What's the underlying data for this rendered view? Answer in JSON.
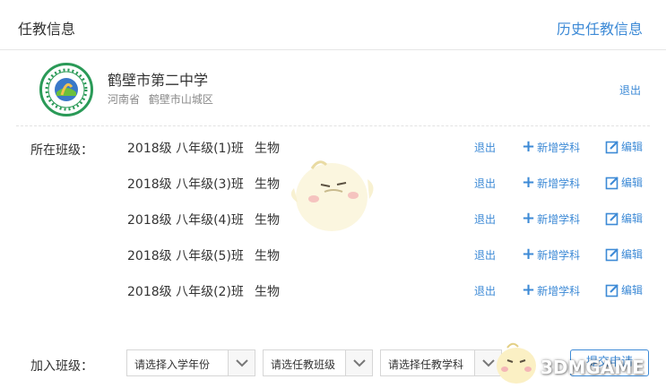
{
  "header": {
    "title": "任教信息",
    "history_link": "历史任教信息"
  },
  "school": {
    "name": "鹤壁市第二中学",
    "province": "河南省",
    "city_district": "鹤壁市山城区",
    "exit_label": "退出"
  },
  "classes": {
    "label": "所在班级：",
    "rows": [
      {
        "grade": "2018级 八年级(1)班",
        "subject": "生物",
        "exit": "退出",
        "add": "新增学科",
        "edit": "编辑"
      },
      {
        "grade": "2018级 八年级(3)班",
        "subject": "生物",
        "exit": "退出",
        "add": "新增学科",
        "edit": "编辑"
      },
      {
        "grade": "2018级 八年级(4)班",
        "subject": "生物",
        "exit": "退出",
        "add": "新增学科",
        "edit": "编辑"
      },
      {
        "grade": "2018级 八年级(5)班",
        "subject": "生物",
        "exit": "退出",
        "add": "新增学科",
        "edit": "编辑"
      },
      {
        "grade": "2018级 八年级(2)班",
        "subject": "生物",
        "exit": "退出",
        "add": "新增学科",
        "edit": "编辑"
      }
    ]
  },
  "join": {
    "label": "加入班级：",
    "year_select": "请选择入学年份",
    "class_select": "请选任教班级",
    "subject_select": "请选择任教学科",
    "submit": "提交申请"
  },
  "watermark": "3DMGAME",
  "colors": {
    "accent": "#3d8ad6",
    "text": "#333333",
    "muted": "#888888"
  }
}
